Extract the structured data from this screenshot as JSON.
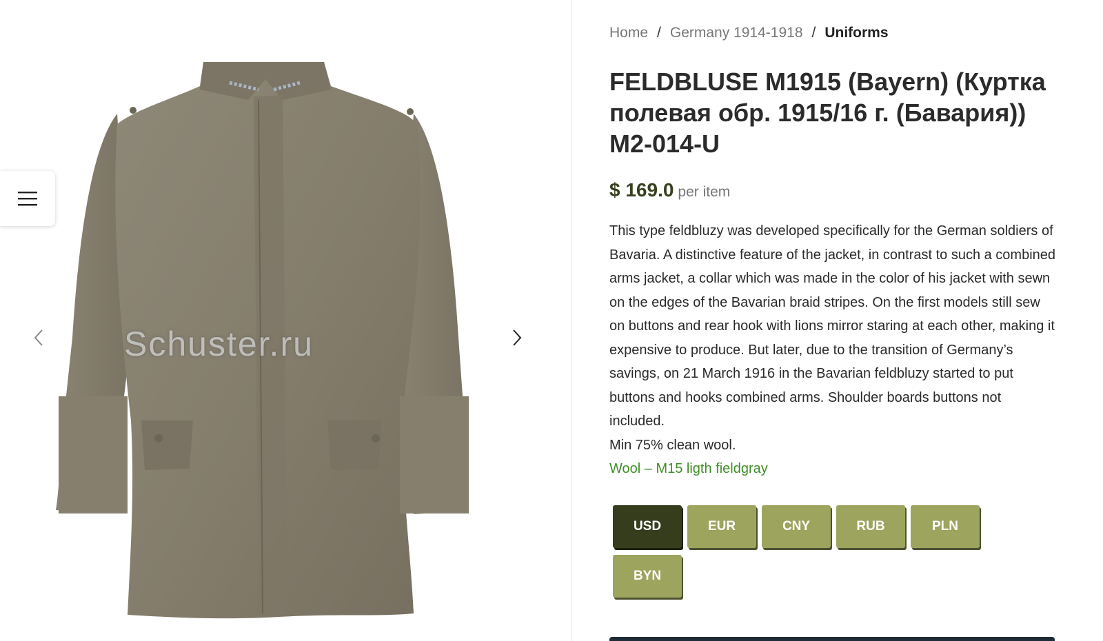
{
  "gallery": {
    "image_alt": "FELDBLUSE M1915 jacket",
    "watermark": "Schuster.ru",
    "menu_icon": "hamburger-icon",
    "prev_icon": "chevron-left-icon",
    "next_icon": "chevron-right-icon"
  },
  "breadcrumb": {
    "home": "Home",
    "category": "Germany 1914-1918",
    "current": "Uniforms",
    "separator": "/"
  },
  "product": {
    "title": "FELDBLUSE M1915 (Bayern) (Куртка полевая обр. 1915/16 г. (Бавария)) M2-014-U",
    "price": "$ 169.0",
    "unit": "per item",
    "description": "This type feldbluzy was developed specifically for the German soldiers of Bavaria. A distinctive feature of the jacket, in contrast to such a combined arms jacket, a collar which was made in the color of his jacket with sewn on the edges of the Bavarian braid stripes. On the first models still sew on buttons and rear hook with lions mirror staring at each other, making it expensive to produce. But later, due to the transition of Germany’s savings, on 21 March 1916 in the Bavarian feldbluzy started to put buttons and hooks combined arms. Shoulder boards buttons not included.",
    "wool_note": "Min 75% clean wool.",
    "variant": "Wool – M15 ligth fieldgray"
  },
  "currencies": {
    "selected": "USD",
    "options": [
      "USD",
      "EUR",
      "CNY",
      "RUB",
      "PLN",
      "BYN"
    ]
  },
  "colors": {
    "accent_active": "#363d1c",
    "accent": "#9da45e",
    "price": "#38411f",
    "variant_link": "#3f8d27"
  }
}
